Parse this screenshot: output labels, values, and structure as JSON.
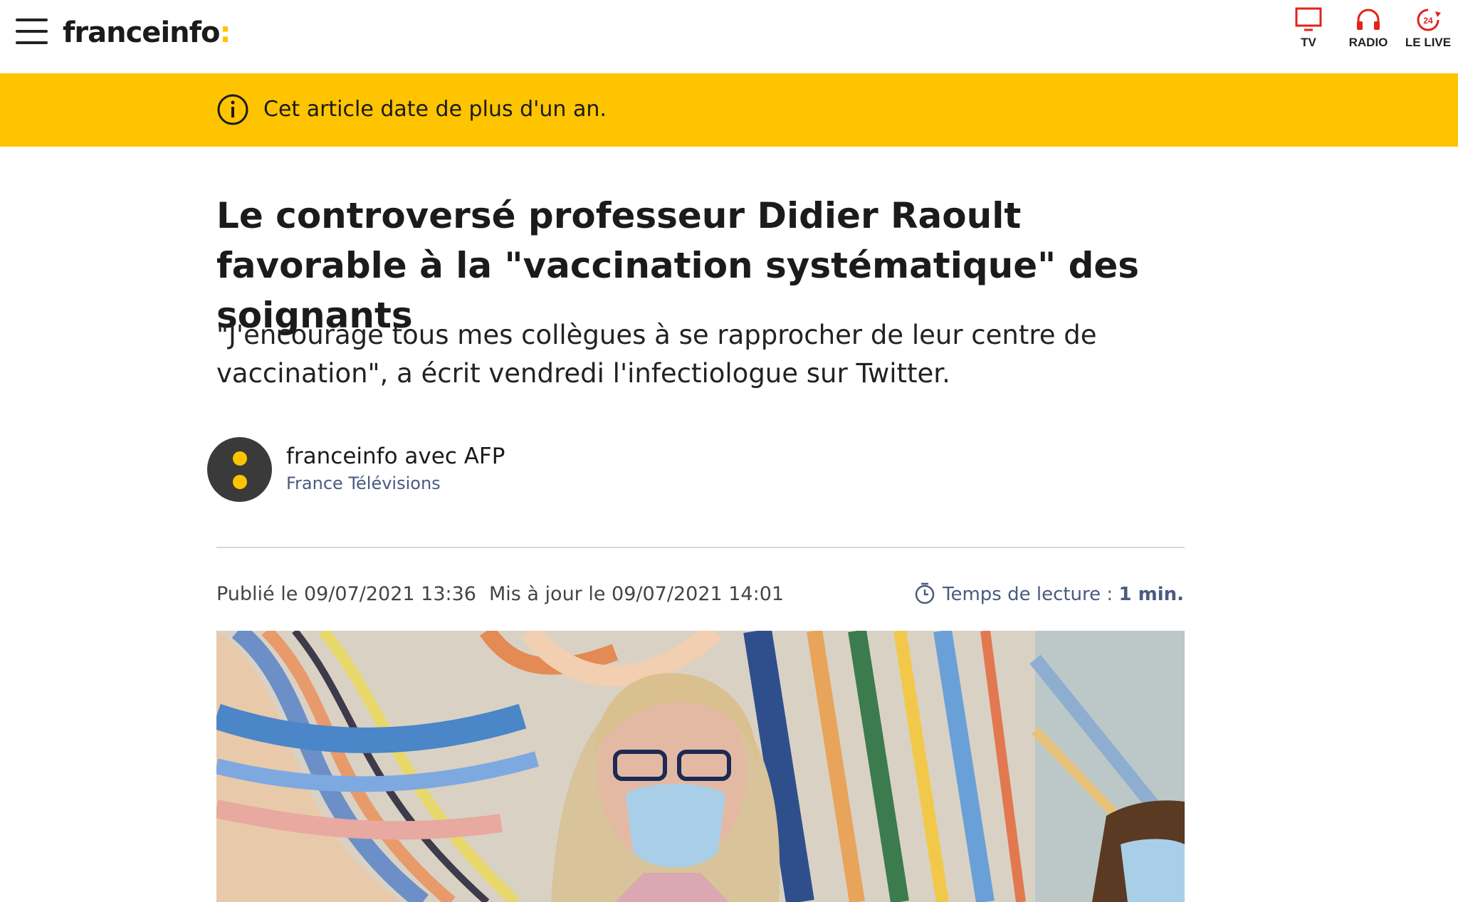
{
  "header": {
    "logo_text": "franceinfo",
    "logo_colon": ":",
    "menu_icon": "hamburger-menu-icon",
    "nav": [
      {
        "label": "TV",
        "icon": "tv-icon"
      },
      {
        "label": "RADIO",
        "icon": "headphones-icon"
      },
      {
        "label": "LE LIVE",
        "icon": "live-24-icon"
      }
    ],
    "live_badge": "24"
  },
  "banner": {
    "text": "Cet article date de plus d'un an.",
    "icon": "info-icon"
  },
  "article": {
    "title": "Le controversé professeur Didier Raoult favorable à la \"vaccination systématique\" des soignants",
    "subtitle": "\"J'encourage tous mes collègues à se rapprocher de leur centre de vaccination\", a écrit vendredi l'infectiologue sur Twitter.",
    "author": "franceinfo avec AFP",
    "organization": "France Télévisions",
    "published": "Publié le 09/07/2021 13:36",
    "updated": "Mis à jour le 09/07/2021 14:01",
    "reading_label": "Temps de lecture :",
    "reading_value": "1 min."
  },
  "colors": {
    "brand_yellow": "#fec400",
    "nav_red": "#e2231a",
    "meta_blue": "#4a5b80"
  }
}
